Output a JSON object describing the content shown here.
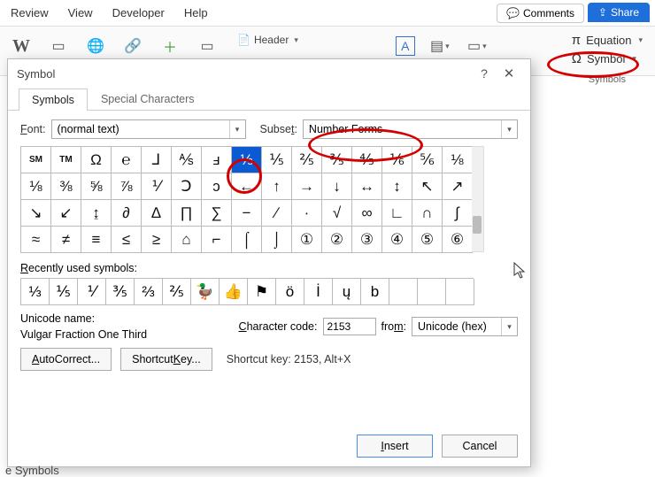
{
  "menu": {
    "review": "Review",
    "view": "View",
    "developer": "Developer",
    "help": "Help",
    "comments": "Comments",
    "share": "Share"
  },
  "ribbon": {
    "header": "Header",
    "equation": "Equation",
    "symbol": "Symbol",
    "group_label": "Symbols"
  },
  "dialog": {
    "title": "Symbol",
    "tab_symbols": "Symbols",
    "tab_special": "Special Characters",
    "font_label": "Font:",
    "font_value": "(normal text)",
    "subset_label": "Subset:",
    "subset_value": "Number Forms",
    "recent_label": "Recently used symbols:",
    "unicode_label": "Unicode name:",
    "unicode_name": "Vulgar Fraction One Third",
    "charcode_label": "Character code:",
    "charcode_value": "2153",
    "from_label": "from:",
    "from_value": "Unicode (hex)",
    "autocorrect": "AutoCorrect...",
    "shortcutkey_btn": "Shortcut Key...",
    "shortcut_text": "Shortcut key: 2153, Alt+X",
    "insert": "Insert",
    "cancel": "Cancel"
  },
  "grid": [
    "℠",
    "™",
    "Ω",
    "℮",
    "⅃",
    "⅍",
    "ⅎ",
    "⅓",
    "⅕",
    "⅖",
    "⅗",
    "⅘",
    "⅙",
    "⅚",
    "⅛",
    "⅛",
    "⅜",
    "⅝",
    "⅞",
    "⅟",
    "Ↄ",
    "ↄ",
    "←",
    "↑",
    "→",
    "↓",
    "↔",
    "↕",
    "↖",
    "↗",
    "↘",
    "↙",
    "↨",
    "∂",
    "∆",
    "∏",
    "∑",
    "−",
    "∕",
    "∙",
    "√",
    "∞",
    "∟",
    "∩",
    "∫",
    "≈",
    "≠",
    "≡",
    "≤",
    "≥",
    "⌂",
    "⌐",
    "⌠",
    "⌡",
    "①",
    "②",
    "③",
    "④",
    "⑤",
    "⑥"
  ],
  "selected_index": 7,
  "recent": [
    "⅓",
    "⅕",
    "⅟",
    "⅗",
    "⅔",
    "⅖",
    "🦆",
    "👍",
    "⚑",
    "ö",
    "İ",
    "ų",
    "b",
    "",
    "",
    ""
  ],
  "status_fragment": "e Symbols"
}
